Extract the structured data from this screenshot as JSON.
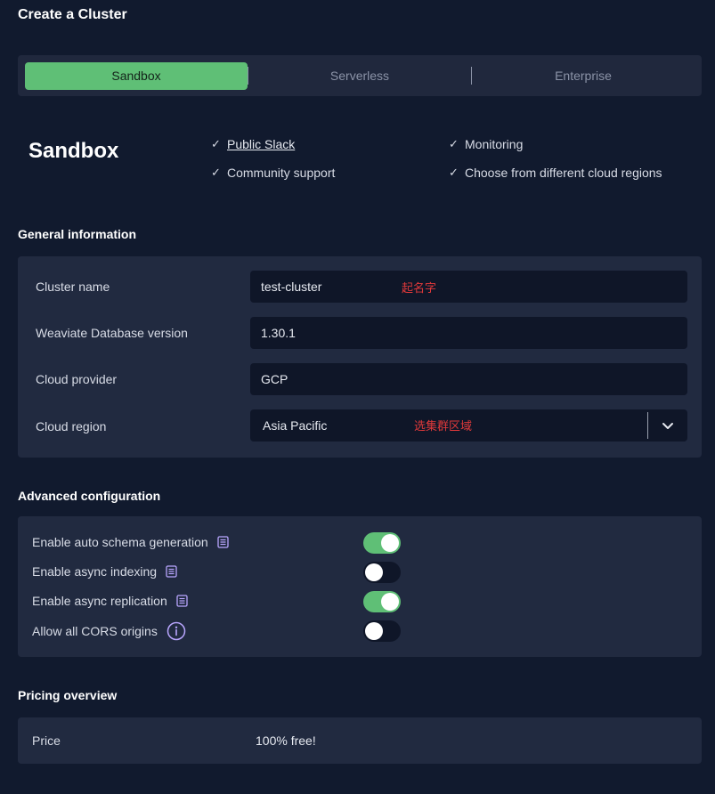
{
  "page": {
    "title": "Create a Cluster"
  },
  "tabs": [
    {
      "label": "Sandbox",
      "active": true
    },
    {
      "label": "Serverless",
      "active": false
    },
    {
      "label": "Enterprise",
      "active": false
    }
  ],
  "plan": {
    "name": "Sandbox",
    "features": [
      {
        "label": "Public Slack",
        "link": true
      },
      {
        "label": "Monitoring",
        "link": false
      },
      {
        "label": "Community support",
        "link": false
      },
      {
        "label": "Choose from different cloud regions",
        "link": false
      }
    ]
  },
  "general": {
    "title": "General information",
    "fields": [
      {
        "label": "Cluster name",
        "value": "test-cluster",
        "annotation": "起名字"
      },
      {
        "label": "Weaviate Database version",
        "value": "1.30.1"
      },
      {
        "label": "Cloud provider",
        "value": "GCP"
      },
      {
        "label": "Cloud region",
        "value": "Asia Pacific",
        "annotation": "选集群区域"
      }
    ]
  },
  "advanced": {
    "title": "Advanced configuration",
    "options": [
      {
        "label": "Enable auto schema generation",
        "icon": "doc-icon",
        "enabled": true
      },
      {
        "label": "Enable async indexing",
        "icon": "doc-icon",
        "enabled": false
      },
      {
        "label": "Enable async replication",
        "icon": "doc-icon",
        "enabled": true
      },
      {
        "label": "Allow all CORS origins",
        "icon": "info-icon",
        "enabled": false
      }
    ]
  },
  "pricing": {
    "title": "Pricing overview",
    "label": "Price",
    "value": "100% free!"
  },
  "colors": {
    "background": "#111a2e",
    "card": "#212a40",
    "field": "#0f1628",
    "accent": "#5fbf76",
    "annotation": "#e0393a",
    "icon": "#b9a6ff"
  }
}
